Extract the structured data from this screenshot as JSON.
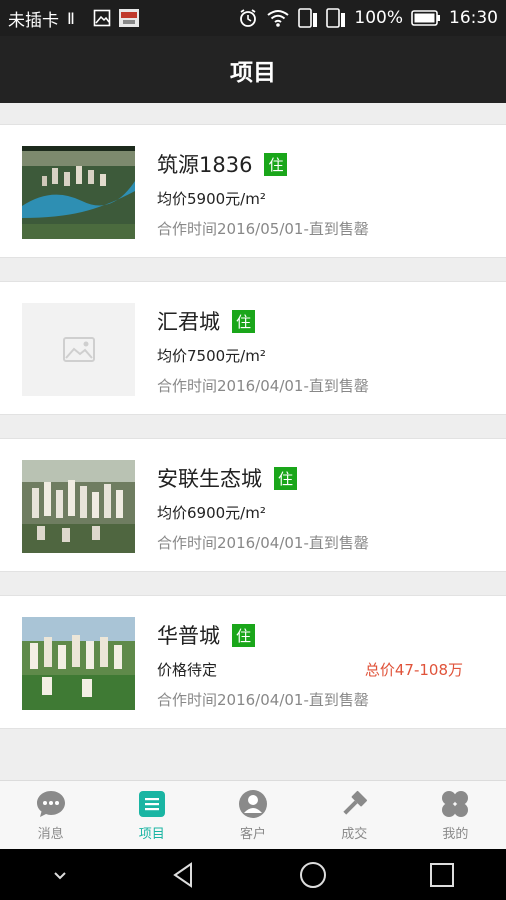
{
  "status_bar": {
    "carrier": "未插卡",
    "battery": "100%",
    "time": "16:30"
  },
  "header": {
    "title": "项目"
  },
  "projects": [
    {
      "name": "筑源1836",
      "badge": "住",
      "price": "均价5900元/m²",
      "total": "",
      "coop": "合作时间2016/05/01-直到售罄",
      "thumb": "aerial-river"
    },
    {
      "name": "汇君城",
      "badge": "住",
      "price": "均价7500元/m²",
      "total": "",
      "coop": "合作时间2016/04/01-直到售罄",
      "thumb": "placeholder"
    },
    {
      "name": "安联生态城",
      "badge": "住",
      "price": "均价6900元/m²",
      "total": "",
      "coop": "合作时间2016/04/01-直到售罄",
      "thumb": "aerial-towers"
    },
    {
      "name": "华普城",
      "badge": "住",
      "price": "价格待定",
      "total": "总价47-108万",
      "coop": "合作时间2016/04/01-直到售罄",
      "thumb": "aerial-green"
    }
  ],
  "tabs": [
    {
      "label": "消息",
      "icon": "chat-bubble-icon",
      "active": false
    },
    {
      "label": "项目",
      "icon": "list-icon",
      "active": true
    },
    {
      "label": "客户",
      "icon": "person-icon",
      "active": false
    },
    {
      "label": "成交",
      "icon": "gavel-icon",
      "active": false
    },
    {
      "label": "我的",
      "icon": "clover-icon",
      "active": false
    }
  ],
  "colors": {
    "accent": "#1ab5a3",
    "badge": "#1aa61a",
    "total_price": "#e0533a",
    "header": "#232323"
  }
}
